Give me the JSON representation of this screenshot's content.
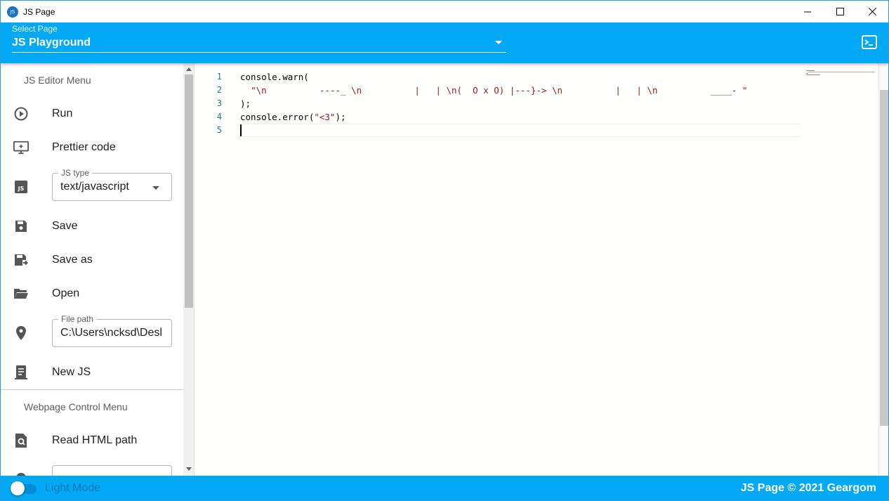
{
  "window": {
    "title": "JS Page",
    "icon": "app-logo-icon",
    "controls": [
      "minimize-icon",
      "maximize-icon",
      "close-icon"
    ]
  },
  "header": {
    "select_label": "Select Page",
    "select_value": "JS Playground",
    "terminal_icon": "terminal-icon",
    "accent_color": "#03a9f4"
  },
  "sidebar": {
    "js_menu_title": "JS Editor Menu",
    "run": "Run",
    "prettier": "Prettier code",
    "js_type": {
      "legend": "JS type",
      "value": "text/javascript"
    },
    "save": "Save",
    "save_as": "Save as",
    "open": "Open",
    "file_path": {
      "legend": "File path",
      "value": "C:\\Users\\ncksd\\Desl"
    },
    "new_js": "New JS",
    "web_menu_title": "Webpage Control Menu",
    "read_html": "Read HTML path"
  },
  "editor": {
    "line_numbers": [
      "1",
      "2",
      "3",
      "4",
      "5"
    ],
    "lines": {
      "l1": "console.warn(",
      "l2_indent": "  ",
      "l2_string": "\"\\n          ----_ \\n          |   | \\n(  O x O) |---}-> \\n          |   | \\n          ____- \"",
      "l3": ");",
      "l4_prefix": "console.error(",
      "l4_string": "\"<3\"",
      "l4_suffix": ");",
      "l5": ""
    }
  },
  "footer": {
    "light_mode_label": "Light Mode",
    "light_mode_on": false,
    "copyright": "JS Page © 2021 Geargom"
  }
}
